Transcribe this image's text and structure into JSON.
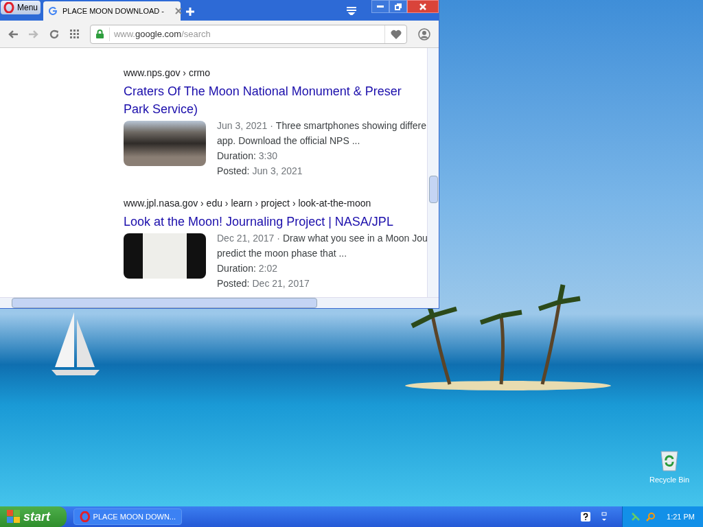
{
  "browser": {
    "menu_button": "Menu",
    "tabs": [
      {
        "title": "PLACE MOON DOWNLOAD -",
        "selected": true
      }
    ],
    "address": {
      "prefix": "www.",
      "host": "google.com",
      "path": "/search",
      "secure": true
    },
    "results": [
      {
        "breadcrumb": "www.nps.gov › crmo",
        "title": "Craters Of The Moon National Monument & Preser",
        "title_line_2": "Park Service)",
        "date": "Jun 3, 2021",
        "separator": "·",
        "snippet": "Three smartphones showing differe",
        "snippet_line_2": "app. Download the official NPS ...",
        "duration_label": "Duration:",
        "duration": "3:30",
        "posted_label": "Posted:",
        "posted": "Jun 3, 2021",
        "kind": "landscape"
      },
      {
        "breadcrumb": "www.jpl.nasa.gov › edu › learn › project › look-at-the-moon",
        "title": "Look at the Moon! Journaling Project | NASA/JPL",
        "date": "Dec 21, 2017",
        "separator": "·",
        "snippet": "Draw what you see in a Moon Jou",
        "snippet_line_2": "predict the moon phase that ...",
        "duration_label": "Duration:",
        "duration": "2:02",
        "posted_label": "Posted:",
        "posted": "Dec 21, 2017",
        "kind": "worksheet"
      }
    ]
  },
  "desktop_icons": [
    {
      "label": "Recycle Bin"
    }
  ],
  "taskbar": {
    "start": "start",
    "tasks": [
      {
        "label": "PLACE MOON DOWN...",
        "selected": false
      }
    ],
    "clock": "1:21 PM"
  }
}
